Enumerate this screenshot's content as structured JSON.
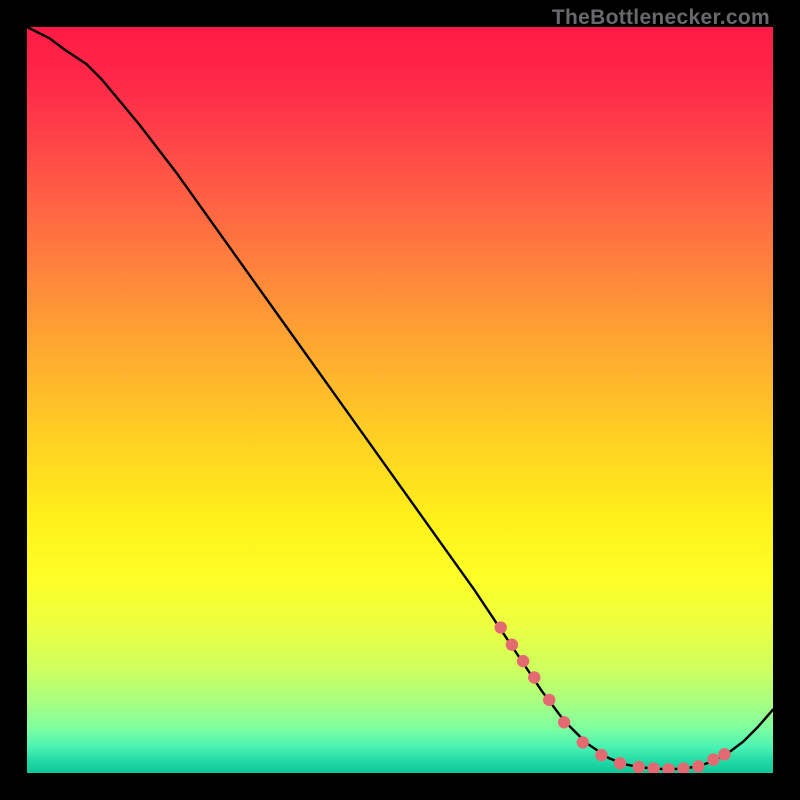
{
  "watermark": "TheBottlenecker.com",
  "chart_data": {
    "type": "line",
    "title": "",
    "xlabel": "",
    "ylabel": "",
    "xlim": [
      0,
      100
    ],
    "ylim": [
      0,
      100
    ],
    "grid": false,
    "series": [
      {
        "name": "curve",
        "x": [
          0,
          3,
          5,
          8,
          10,
          15,
          20,
          25,
          30,
          35,
          40,
          45,
          50,
          55,
          60,
          63,
          66,
          69,
          72,
          75,
          78,
          80,
          82,
          84,
          86,
          88,
          90,
          92,
          94,
          96,
          98,
          100
        ],
        "y": [
          100,
          98.5,
          97,
          95,
          93,
          87,
          80.5,
          73.5,
          66.5,
          59.5,
          52.5,
          45.5,
          38.5,
          31.5,
          24.5,
          20,
          15.5,
          11,
          7,
          4,
          2,
          1.2,
          0.8,
          0.6,
          0.5,
          0.6,
          0.9,
          1.6,
          2.7,
          4.2,
          6.2,
          8.5
        ]
      }
    ],
    "markers": {
      "x": [
        63.5,
        65,
        66.5,
        68,
        70,
        72,
        74.5,
        77,
        79.5,
        82,
        84,
        86,
        88,
        90,
        92,
        93.5
      ],
      "y": [
        19.5,
        17.2,
        15.0,
        12.8,
        9.8,
        6.8,
        4.1,
        2.4,
        1.3,
        0.8,
        0.6,
        0.5,
        0.6,
        0.9,
        1.8,
        2.5
      ]
    },
    "background_gradient": {
      "stops": [
        {
          "pos": 0.0,
          "color": "#ff1a45"
        },
        {
          "pos": 0.08,
          "color": "#ff2a48"
        },
        {
          "pos": 0.18,
          "color": "#ff4e47"
        },
        {
          "pos": 0.3,
          "color": "#ff7a3f"
        },
        {
          "pos": 0.42,
          "color": "#ffa531"
        },
        {
          "pos": 0.55,
          "color": "#ffd023"
        },
        {
          "pos": 0.66,
          "color": "#fff01a"
        },
        {
          "pos": 0.74,
          "color": "#fdff27"
        },
        {
          "pos": 0.8,
          "color": "#ecff3f"
        },
        {
          "pos": 0.86,
          "color": "#cfff5e"
        },
        {
          "pos": 0.905,
          "color": "#a8ff80"
        },
        {
          "pos": 0.94,
          "color": "#7effa0"
        },
        {
          "pos": 0.965,
          "color": "#4bf2b3"
        },
        {
          "pos": 0.985,
          "color": "#1fd9a6"
        },
        {
          "pos": 1.0,
          "color": "#0fc796"
        }
      ]
    }
  }
}
